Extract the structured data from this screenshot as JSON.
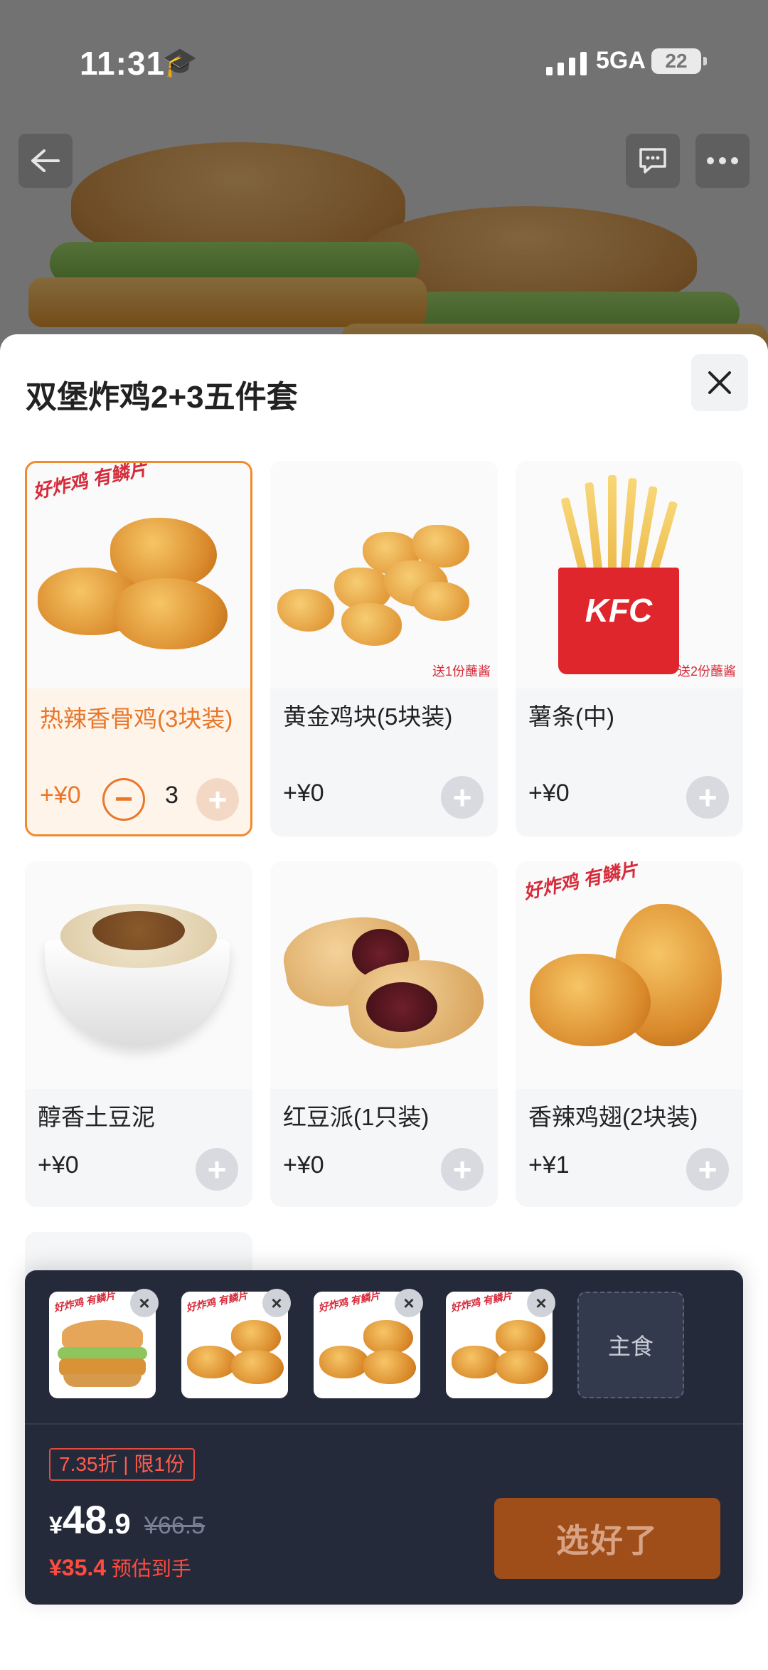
{
  "status_bar": {
    "time": "11:31",
    "network": "5GA",
    "battery": "22"
  },
  "sheet": {
    "title": "双堡炸鸡2+3五件套"
  },
  "items": [
    {
      "name": "热辣香骨鸡(3块装)",
      "price": "+¥0",
      "quantity": "3",
      "selected": true,
      "promo": "好炸鸡 有鳞片"
    },
    {
      "name": "黄金鸡块(5块装)",
      "price": "+¥0",
      "note": "送1份蘸酱"
    },
    {
      "name": "薯条(中)",
      "price": "+¥0",
      "note": "送2份蘸酱",
      "box_label": "KFC"
    },
    {
      "name": "醇香土豆泥",
      "price": "+¥0"
    },
    {
      "name": "红豆派(1只装)",
      "price": "+¥0"
    },
    {
      "name": "香辣鸡翅(2块装)",
      "price": "+¥1",
      "promo": "好炸鸡 有鳞片"
    }
  ],
  "cart": {
    "main_slot_label": "主食",
    "discount": "7.35折 | 限1份",
    "price_symbol": "¥",
    "price_int": "48",
    "price_dec": ".9",
    "price_original": "¥66.5",
    "estimate_amount": "¥35.4",
    "estimate_label": "预估到手",
    "confirm_label": "选好了",
    "thumb_promo": "好炸鸡 有鳞片"
  },
  "colors": {
    "accent": "#e8772a",
    "panel": "#252a3a",
    "confirm": "#9f4d19",
    "discount": "#ff5c4e"
  }
}
